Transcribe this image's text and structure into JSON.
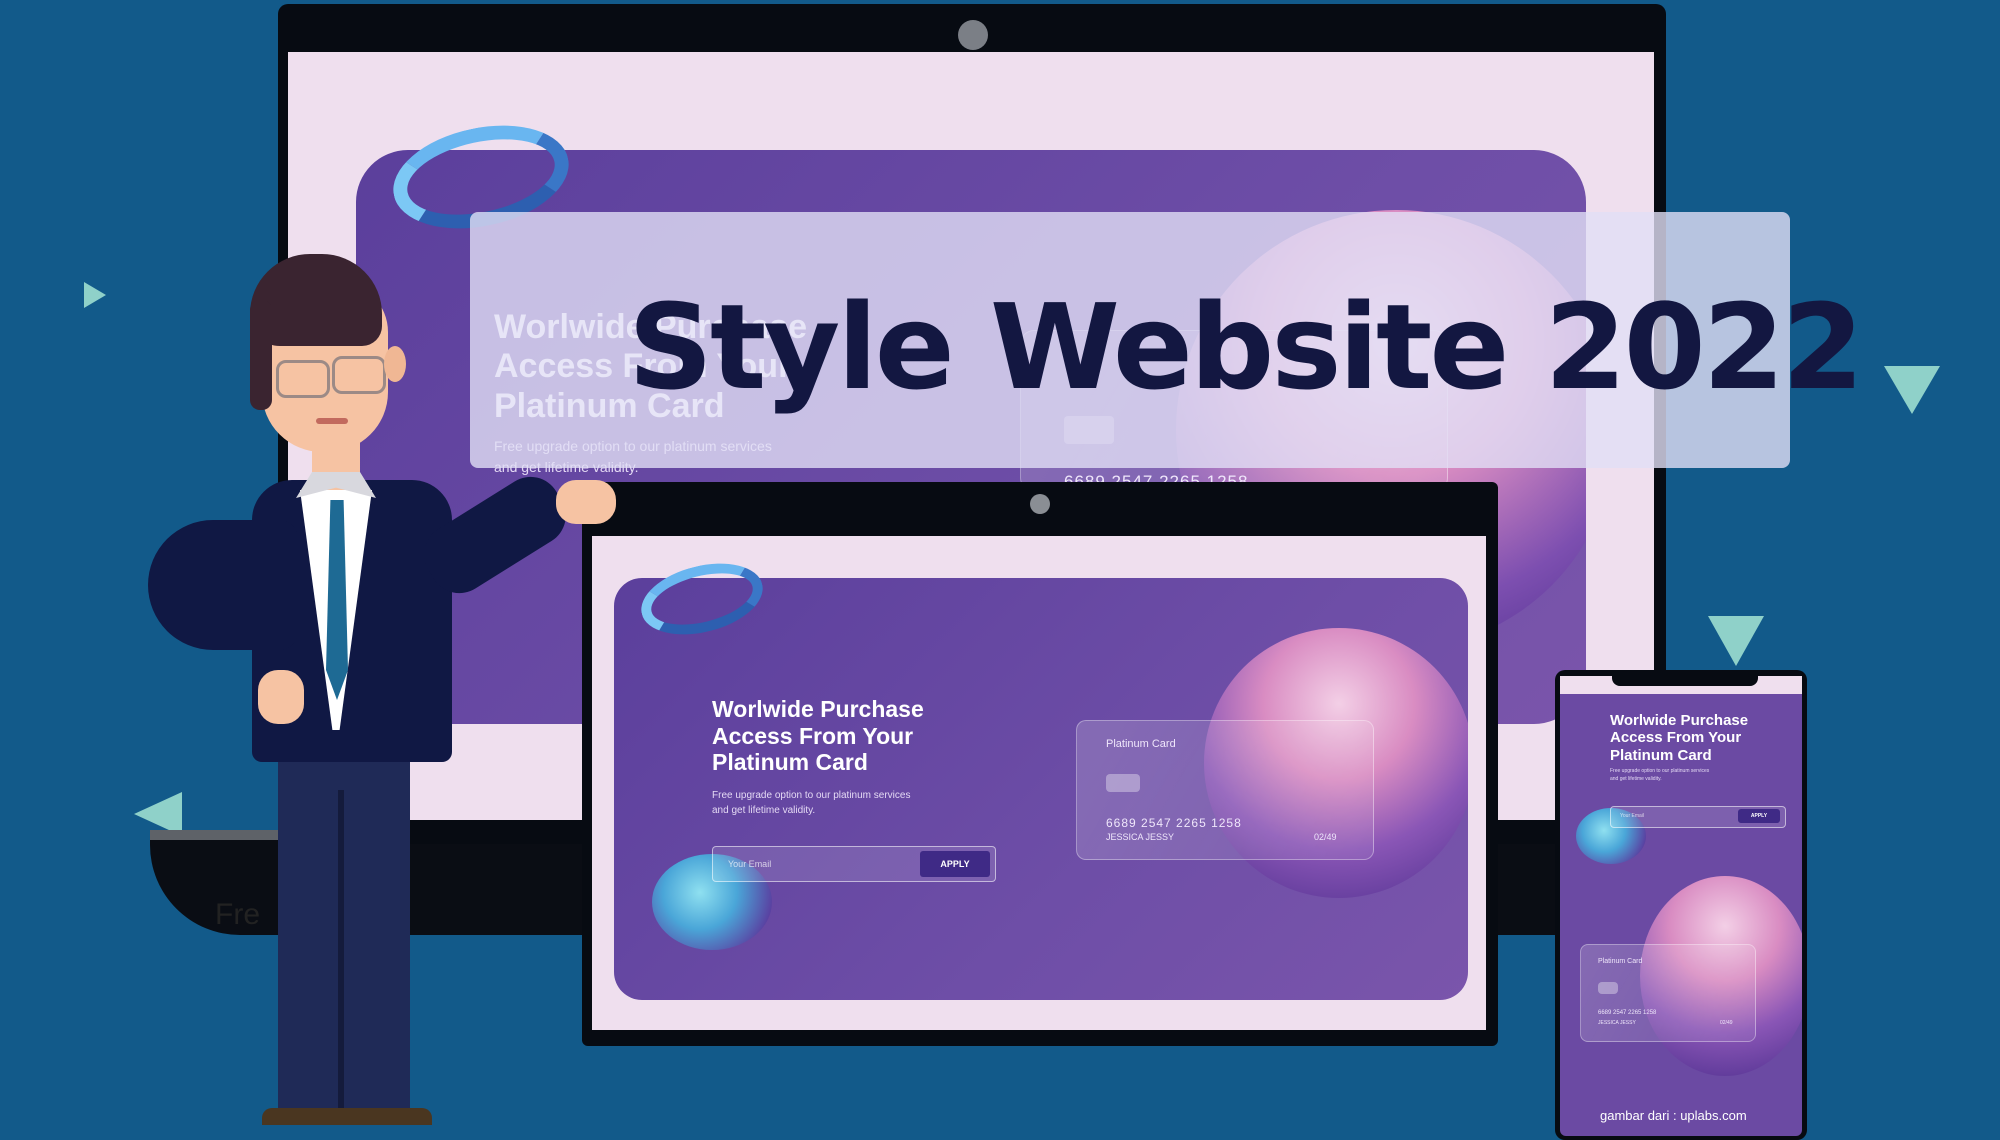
{
  "banner": {
    "title": "Style Website 2022"
  },
  "hero": {
    "title": "Worlwide Purchase\nAccess From Your\nPlatinum Card",
    "description": "Free upgrade option to our platinum services\nand get lifetime validity.",
    "email_placeholder": "Your Email",
    "apply_label": "APPLY"
  },
  "card": {
    "label": "Platinum Card",
    "number": "6689 2547 2265 1258",
    "holder": "JESSICA JESSY",
    "expiry": "02/49"
  },
  "monitor_base_text": "Fre",
  "credit": "gambar dari : uplabs.com",
  "colors": {
    "background": "#125a8a",
    "hero_purple": "#6a4aa3",
    "banner_text": "#131741",
    "accent_teal": "#8fd1c9"
  }
}
